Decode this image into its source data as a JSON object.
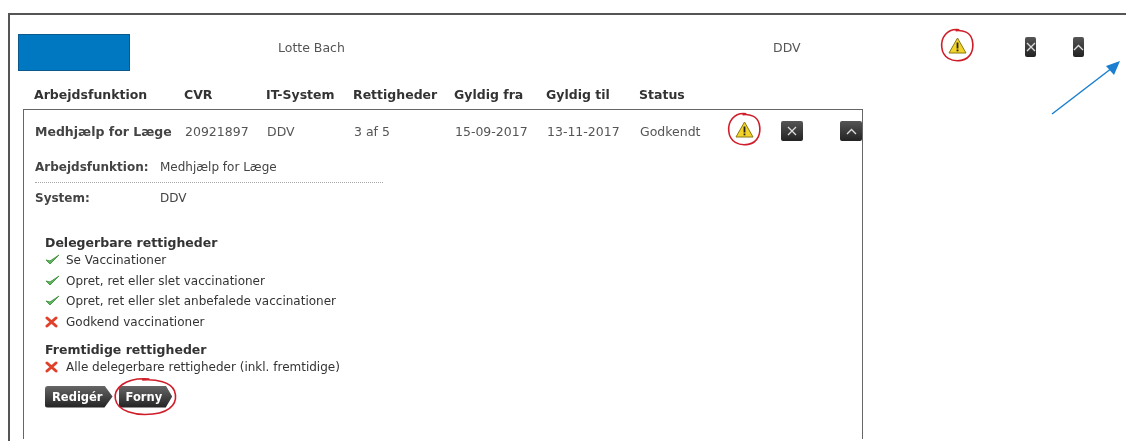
{
  "summary": {
    "name": "Lotte Bach",
    "system": "DDV",
    "warning": {
      "circled": true
    }
  },
  "columns": [
    "Arbejdsfunktion",
    "CVR",
    "IT-System",
    "Rettigheder",
    "Gyldig fra",
    "Gyldig til",
    "Status"
  ],
  "row": {
    "cells": [
      "Medhjælp for Læge",
      "20921897",
      "DDV",
      "3 af 5",
      "15-09-2017",
      "13-11-2017",
      "Godkendt"
    ],
    "warning": {
      "circled": true
    },
    "details": [
      {
        "label": "Arbejdsfunktion:",
        "value": "Medhjælp for Læge"
      },
      {
        "label": "System:",
        "value": "DDV"
      }
    ],
    "sections": [
      {
        "title": "Delegerbare rettigheder",
        "items": [
          {
            "text": "Se Vaccinationer",
            "granted": true
          },
          {
            "text": "Opret, ret eller slet vaccinationer",
            "granted": true
          },
          {
            "text": "Opret, ret eller slet anbefalede vaccinationer",
            "granted": true
          },
          {
            "text": "Godkend vaccinationer",
            "granted": false
          }
        ]
      },
      {
        "title": "Fremtidige rettigheder",
        "items": [
          {
            "text": "Alle delegerbare rettigheder (inkl. fremtidige)",
            "granted": false
          }
        ]
      }
    ],
    "buttons": [
      {
        "label": "Redigér",
        "circled": false
      },
      {
        "label": "Forny",
        "circled": true
      }
    ]
  }
}
